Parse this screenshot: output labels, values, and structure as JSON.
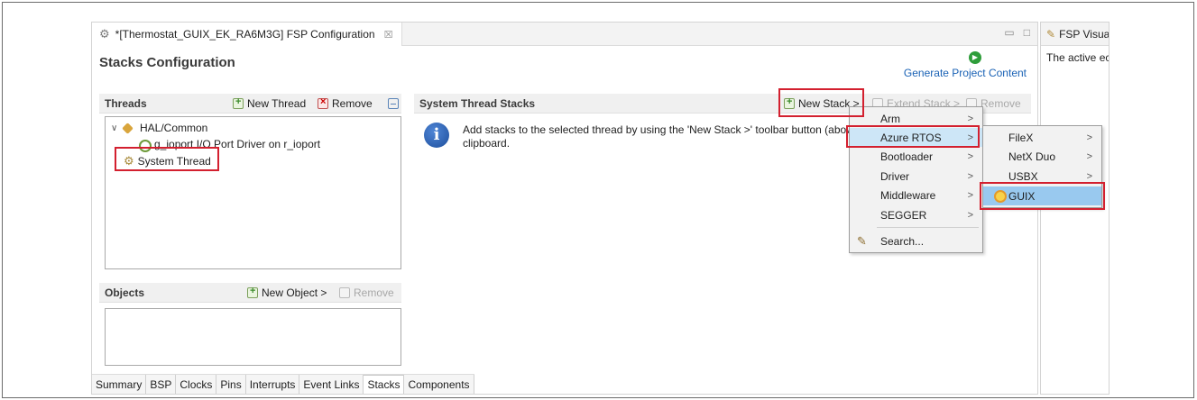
{
  "editor": {
    "tab_title": "*[Thermostat_GUIX_EK_RA6M3G] FSP Configuration",
    "tab_close": "☒",
    "window_buttons": [
      "▭",
      "□"
    ],
    "page_title": "Stacks Configuration",
    "generate_label": "Generate Project Content"
  },
  "threads": {
    "title": "Threads",
    "new_thread": "New Thread",
    "remove": "Remove",
    "tree": [
      {
        "label": "HAL/Common"
      },
      {
        "label": "g_ioport I/O Port Driver on r_ioport"
      },
      {
        "label": "System Thread"
      }
    ]
  },
  "objects": {
    "title": "Objects",
    "new_object": "New Object >",
    "remove": "Remove"
  },
  "stacks": {
    "title": "System Thread Stacks",
    "new_stack": "New Stack >",
    "extend_stack": "Extend Stack >",
    "remove": "Remove",
    "info_line1": "Add stacks to the selected thread by using the 'New Stack >' toolbar button (above",
    "info_line2": "clipboard."
  },
  "bottom_tabs": [
    "Summary",
    "BSP",
    "Clocks",
    "Pins",
    "Interrupts",
    "Event Links",
    "Stacks",
    "Components"
  ],
  "active_bottom_tab": "Stacks",
  "right_panel": {
    "tab_title": "FSP Visua",
    "body_text": "The active ec"
  },
  "menu1": {
    "items": [
      {
        "label": "Arm",
        "arrow": ">"
      },
      {
        "label": "Azure RTOS",
        "arrow": ">"
      },
      {
        "label": "Bootloader",
        "arrow": ">"
      },
      {
        "label": "Driver",
        "arrow": ">"
      },
      {
        "label": "Middleware",
        "arrow": ">"
      },
      {
        "label": "SEGGER",
        "arrow": ">"
      },
      {
        "label": "Search...",
        "arrow": ""
      }
    ],
    "highlighted": "Azure RTOS"
  },
  "menu2": {
    "items": [
      {
        "label": "FileX",
        "arrow": ">"
      },
      {
        "label": "NetX Duo",
        "arrow": ">"
      },
      {
        "label": "USBX",
        "arrow": ">"
      },
      {
        "label": "GUIX",
        "arrow": ""
      }
    ],
    "selected": "GUIX"
  },
  "colors": {
    "highlight_box": "#d3202f",
    "link": "#1a62b5",
    "menu_selected": "#99c9ef",
    "menu_hover": "#cde6f7"
  }
}
